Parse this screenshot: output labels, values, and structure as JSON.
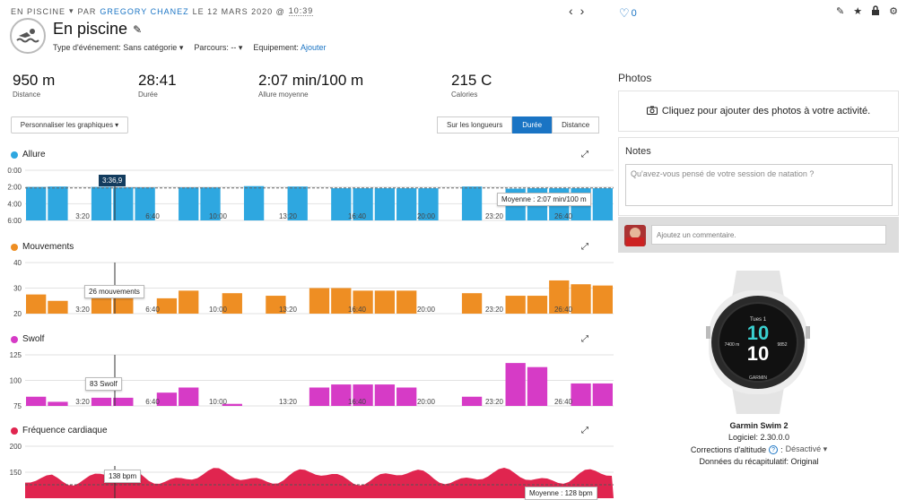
{
  "header": {
    "category": "EN PISCINE",
    "by": "PAR",
    "author": "GREGORY CHANEZ",
    "date": "LE 12 MARS 2020 @",
    "time": "10:39",
    "likes": "0",
    "title": "En piscine"
  },
  "meta": {
    "event_type_label": "Type d'événement: Sans catégorie",
    "courses_label": "Parcours: --",
    "equipment_label": "Equipement:",
    "equipment_link": "Ajouter"
  },
  "stats": [
    {
      "value": "950 m",
      "label": "Distance"
    },
    {
      "value": "28:41",
      "label": "Durée"
    },
    {
      "value": "2:07 min/100 m",
      "label": "Allure moyenne"
    },
    {
      "value": "215 C",
      "label": "Calories"
    }
  ],
  "controls": {
    "customize_label": "Personnaliser les graphiques",
    "segments": [
      "Sur les longueurs",
      "Durée",
      "Distance"
    ],
    "active_segment": "Durée"
  },
  "charts": {
    "x_ticks": [
      "3:20",
      "6:40",
      "10:00",
      "13:20",
      "16:40",
      "20:00",
      "23:20",
      "26:40"
    ],
    "pace": {
      "title": "Allure",
      "color": "#2ea7e0",
      "y_ticks": [
        "0:00",
        "2:00",
        "4:00",
        "6:00"
      ],
      "cursor_label": "3:36,9",
      "avg_label": "Moyenne : 2:07 min/100 m",
      "values": [
        2.0,
        1.95,
        0,
        2.0,
        2.05,
        2.05,
        0,
        2.05,
        2.05,
        0,
        1.9,
        0,
        1.95,
        0,
        2.15,
        2.15,
        2.15,
        2.15,
        2.15,
        0,
        1.95,
        0,
        2.2,
        2.15,
        2.15,
        2.15,
        2.15
      ]
    },
    "strokes": {
      "title": "Mouvements",
      "color": "#ee8e23",
      "y_ticks": [
        "40",
        "30",
        "20"
      ],
      "tooltip": "26 mouvements",
      "values": [
        27.5,
        25.0,
        0,
        26.0,
        26.0,
        0,
        26.0,
        29.0,
        0,
        28.0,
        0,
        27.0,
        0,
        30.0,
        30.0,
        29.0,
        29.0,
        29.0,
        0,
        0,
        28.0,
        0,
        27.0,
        27.0,
        33.0,
        31.5,
        31.0
      ]
    },
    "swolf": {
      "title": "Swolf",
      "color": "#d63bc6",
      "y_ticks": [
        "125",
        "100",
        "75"
      ],
      "tooltip": "83 Swolf",
      "values": [
        84,
        79,
        0,
        83,
        83,
        0,
        88,
        93,
        0,
        77,
        0,
        0,
        0,
        93,
        96,
        96,
        96,
        93,
        0,
        0,
        84,
        0,
        117,
        113,
        0,
        97,
        97
      ]
    },
    "heart": {
      "title": "Fréquence cardiaque",
      "color": "#e0254f",
      "y_ticks": [
        "200",
        "150"
      ],
      "tooltip": "138 bpm",
      "avg_label": "Moyenne : 128 bpm"
    }
  },
  "sidebar": {
    "photos_title": "Photos",
    "photos_cta": "Cliquez pour ajouter des photos à votre activité.",
    "notes_title": "Notes",
    "notes_placeholder": "Qu'avez-vous pensé de votre session de natation ?",
    "comment_placeholder": "Ajoutez un commentaire.",
    "device_name": "Garmin Swim 2",
    "software": "Logiciel: 2.30.0.0",
    "altitude_label": "Corrections d'altitude",
    "altitude_value": "Désactivé",
    "summary_data": "Données du récapitulatif: Original",
    "watch_day": "Tues 1",
    "watch_hour": "10",
    "watch_min": "10",
    "watch_left": "7400 m",
    "watch_right": "9852",
    "watch_brand": "GARMIN"
  }
}
